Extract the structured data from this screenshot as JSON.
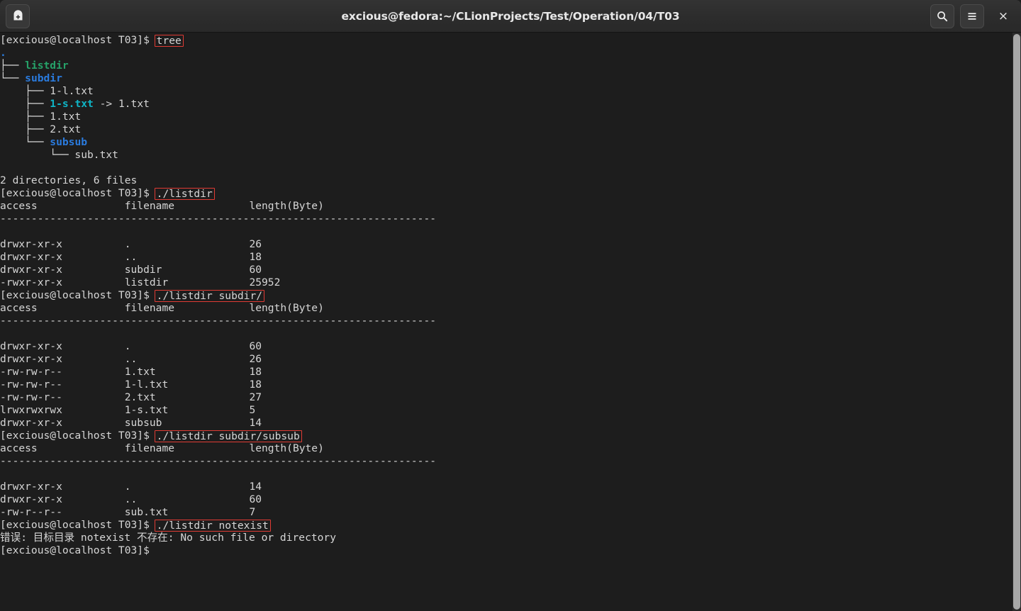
{
  "window": {
    "title": "excious@fedora:~/CLionProjects/Test/Operation/04/T03",
    "background_color": "#1d1d1d",
    "titlebar_color": "#2e2e2e",
    "highlight_color": "#e03b34"
  },
  "titlebar": {
    "new_tab_label": "+",
    "search_label": "",
    "menu_label": "",
    "close_label": "×"
  },
  "terminal": {
    "prompt": "[excious@localhost T03]$ ",
    "colors": {
      "directory": "#2a7bde",
      "executable": "#26a269",
      "symlink": "#0fb5c6",
      "text": "#d6d6d6"
    },
    "lines": [
      {
        "type": "prompt",
        "command": "tree",
        "highlight": true
      },
      {
        "type": "text",
        "segments": [
          {
            "t": ".",
            "c": "blue"
          }
        ]
      },
      {
        "type": "text",
        "segments": [
          {
            "t": "├── ",
            "c": "white"
          },
          {
            "t": "listdir",
            "c": "green"
          }
        ]
      },
      {
        "type": "text",
        "segments": [
          {
            "t": "└── ",
            "c": "white"
          },
          {
            "t": "subdir",
            "c": "blue"
          }
        ]
      },
      {
        "type": "text",
        "segments": [
          {
            "t": "    ├── 1-l.txt",
            "c": "white"
          }
        ]
      },
      {
        "type": "text",
        "segments": [
          {
            "t": "    ├── ",
            "c": "white"
          },
          {
            "t": "1-s.txt",
            "c": "cyan"
          },
          {
            "t": " -> 1.txt",
            "c": "white"
          }
        ]
      },
      {
        "type": "text",
        "segments": [
          {
            "t": "    ├── 1.txt",
            "c": "white"
          }
        ]
      },
      {
        "type": "text",
        "segments": [
          {
            "t": "    ├── 2.txt",
            "c": "white"
          }
        ]
      },
      {
        "type": "text",
        "segments": [
          {
            "t": "    └── ",
            "c": "white"
          },
          {
            "t": "subsub",
            "c": "blue"
          }
        ]
      },
      {
        "type": "text",
        "segments": [
          {
            "t": "        └── sub.txt",
            "c": "white"
          }
        ]
      },
      {
        "type": "blank"
      },
      {
        "type": "text",
        "segments": [
          {
            "t": "2 directories, 6 files",
            "c": "white"
          }
        ]
      },
      {
        "type": "prompt",
        "command": "./listdir",
        "highlight": true
      },
      {
        "type": "text",
        "segments": [
          {
            "t": "access              filename            length(Byte)",
            "c": "white"
          }
        ]
      },
      {
        "type": "text",
        "segments": [
          {
            "t": "----------------------------------------------------------------------",
            "c": "white"
          }
        ]
      },
      {
        "type": "blank"
      },
      {
        "type": "text",
        "segments": [
          {
            "t": "drwxr-xr-x          .                   26",
            "c": "white"
          }
        ]
      },
      {
        "type": "text",
        "segments": [
          {
            "t": "drwxr-xr-x          ..                  18",
            "c": "white"
          }
        ]
      },
      {
        "type": "text",
        "segments": [
          {
            "t": "drwxr-xr-x          subdir              60",
            "c": "white"
          }
        ]
      },
      {
        "type": "text",
        "segments": [
          {
            "t": "-rwxr-xr-x          listdir             25952",
            "c": "white"
          }
        ]
      },
      {
        "type": "prompt",
        "command": "./listdir subdir/",
        "highlight": true
      },
      {
        "type": "text",
        "segments": [
          {
            "t": "access              filename            length(Byte)",
            "c": "white"
          }
        ]
      },
      {
        "type": "text",
        "segments": [
          {
            "t": "----------------------------------------------------------------------",
            "c": "white"
          }
        ]
      },
      {
        "type": "blank"
      },
      {
        "type": "text",
        "segments": [
          {
            "t": "drwxr-xr-x          .                   60",
            "c": "white"
          }
        ]
      },
      {
        "type": "text",
        "segments": [
          {
            "t": "drwxr-xr-x          ..                  26",
            "c": "white"
          }
        ]
      },
      {
        "type": "text",
        "segments": [
          {
            "t": "-rw-rw-r--          1.txt               18",
            "c": "white"
          }
        ]
      },
      {
        "type": "text",
        "segments": [
          {
            "t": "-rw-rw-r--          1-l.txt             18",
            "c": "white"
          }
        ]
      },
      {
        "type": "text",
        "segments": [
          {
            "t": "-rw-rw-r--          2.txt               27",
            "c": "white"
          }
        ]
      },
      {
        "type": "text",
        "segments": [
          {
            "t": "lrwxrwxrwx          1-s.txt             5",
            "c": "white"
          }
        ]
      },
      {
        "type": "text",
        "segments": [
          {
            "t": "drwxr-xr-x          subsub              14",
            "c": "white"
          }
        ]
      },
      {
        "type": "prompt",
        "command": "./listdir subdir/subsub",
        "highlight": true
      },
      {
        "type": "text",
        "segments": [
          {
            "t": "access              filename            length(Byte)",
            "c": "white"
          }
        ]
      },
      {
        "type": "text",
        "segments": [
          {
            "t": "----------------------------------------------------------------------",
            "c": "white"
          }
        ]
      },
      {
        "type": "blank"
      },
      {
        "type": "text",
        "segments": [
          {
            "t": "drwxr-xr-x          .                   14",
            "c": "white"
          }
        ]
      },
      {
        "type": "text",
        "segments": [
          {
            "t": "drwxr-xr-x          ..                  60",
            "c": "white"
          }
        ]
      },
      {
        "type": "text",
        "segments": [
          {
            "t": "-rw-r--r--          sub.txt             7",
            "c": "white"
          }
        ]
      },
      {
        "type": "prompt",
        "command": "./listdir notexist",
        "highlight": true
      },
      {
        "type": "text",
        "segments": [
          {
            "t": "错误: 目标目录 notexist 不存在: No such file or directory",
            "c": "white"
          }
        ]
      },
      {
        "type": "prompt",
        "command": "",
        "highlight": false
      }
    ]
  }
}
